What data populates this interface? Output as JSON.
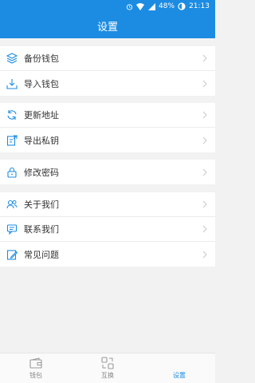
{
  "statusbar": {
    "battery": "48%",
    "time": "21:13"
  },
  "header": {
    "title": "设置"
  },
  "groups": [
    {
      "items": [
        {
          "label": "备份钱包",
          "icon": "layers-icon"
        },
        {
          "label": "导入钱包",
          "icon": "download-icon"
        }
      ]
    },
    {
      "items": [
        {
          "label": "更新地址",
          "icon": "refresh-icon"
        },
        {
          "label": "导出私钥",
          "icon": "export-key-icon"
        }
      ]
    },
    {
      "items": [
        {
          "label": "修改密码",
          "icon": "lock-icon"
        }
      ]
    },
    {
      "items": [
        {
          "label": "关于我们",
          "icon": "people-icon"
        },
        {
          "label": "联系我们",
          "icon": "chat-icon"
        },
        {
          "label": "常见问题",
          "icon": "edit-icon"
        }
      ]
    }
  ],
  "tabs": [
    {
      "label": "钱包",
      "active": false
    },
    {
      "label": "互换",
      "active": false
    },
    {
      "label": "设置",
      "active": true
    }
  ],
  "colors": {
    "accent": "#1c8ce3",
    "background": "#f2f2f2"
  }
}
